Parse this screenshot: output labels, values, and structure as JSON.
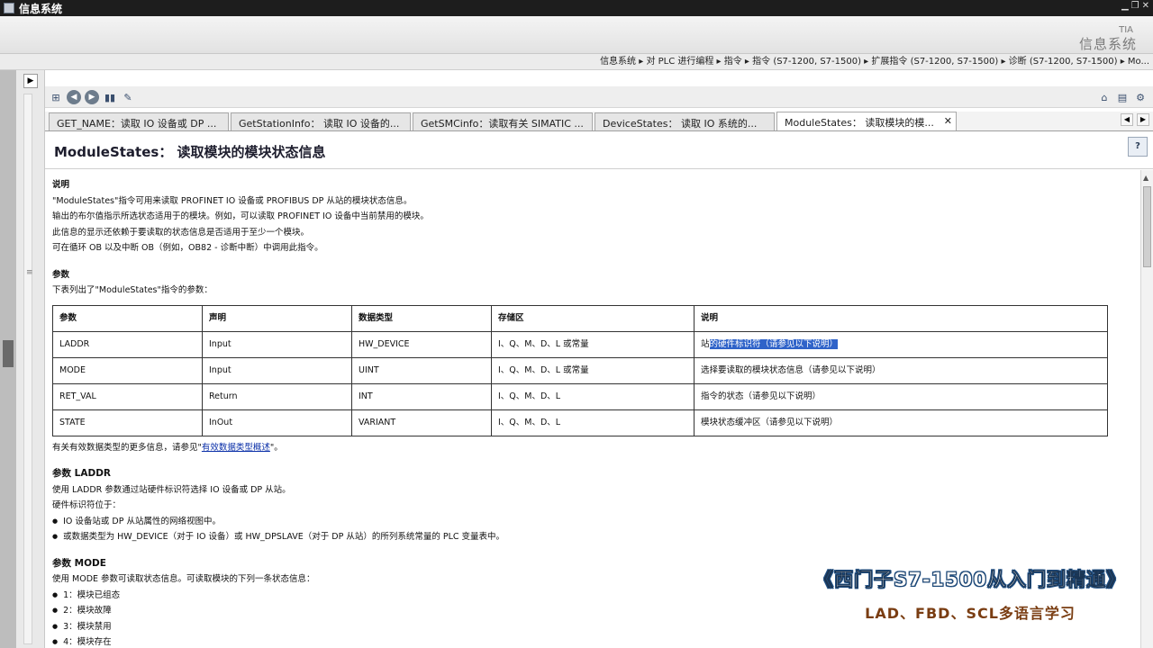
{
  "window": {
    "title": "信息系统",
    "controls": [
      "▁",
      "❐",
      "✕"
    ]
  },
  "brand": {
    "tia": "TIA",
    "name": "信息系统"
  },
  "breadcrumb": "信息系统 ▸ 对 PLC 进行编程 ▸ 指令 ▸ 指令 (S7-1200, S7-1500) ▸ 扩展指令 (S7-1200, S7-1500) ▸ 诊断 (S7-1200, S7-1500) ▸ Mo...",
  "tabs": [
    {
      "label": "GET_NAME：读取 IO 设备或 DP ..."
    },
    {
      "label": "GetStationInfo： 读取 IO 设备的..."
    },
    {
      "label": "GetSMCinfo：读取有关 SIMATIC ..."
    },
    {
      "label": "DeviceStates： 读取 IO 系统的..."
    },
    {
      "label": "ModuleStates： 读取模块的模...",
      "active": true
    }
  ],
  "tab_close": "✕",
  "page": {
    "title": "ModuleStates： 读取模块的模块状态信息"
  },
  "desc": {
    "heading": "说明",
    "lines": [
      "\"ModuleStates\"指令可用来读取 PROFINET IO 设备或 PROFIBUS DP 从站的模块状态信息。",
      "输出的布尔值指示所选状态适用于的模块。例如，可以读取 PROFINET IO 设备中当前禁用的模块。",
      "此信息的显示还依赖于要读取的状态信息是否适用于至少一个模块。",
      "可在循环 OB 以及中断 OB（例如，OB82 - 诊断中断）中调用此指令。"
    ]
  },
  "params": {
    "heading": "参数",
    "intro": "下表列出了\"ModuleStates\"指令的参数：",
    "columns": [
      "参数",
      "声明",
      "数据类型",
      "存储区",
      "说明"
    ],
    "rows": [
      [
        "LADDR",
        "Input",
        "HW_DEVICE",
        "I、Q、M、D、L 或常量",
        "站的硬件标识符（请参见以下说明）"
      ],
      [
        "MODE",
        "Input",
        "UINT",
        "I、Q、M、D、L 或常量",
        "选择要读取的模块状态信息（请参见以下说明）"
      ],
      [
        "RET_VAL",
        "Return",
        "INT",
        "I、Q、M、D、L",
        "指令的状态（请参见以下说明）"
      ],
      [
        "STATE",
        "InOut",
        "VARIANT",
        "I、Q、M、D、L",
        "模块状态缓冲区（请参见以下说明）"
      ]
    ],
    "sel_prefix": "站",
    "sel_text": "的硬件标识符（请参见以下说明）",
    "more_before": "有关有效数据类型的更多信息，请参见\"",
    "more_link": "有效数据类型概述",
    "more_after": "\"。"
  },
  "laddr": {
    "heading": "参数 LADDR",
    "line1": "使用 LADDR 参数通过站硬件标识符选择 IO 设备或 DP 从站。",
    "line2": "硬件标识符位于：",
    "bullets": [
      "IO 设备站或 DP 从站属性的网络视图中。",
      "或数据类型为 HW_DEVICE（对于 IO 设备）或 HW_DPSLAVE（对于 DP 从站）的所列系统常量的 PLC 变量表中。"
    ]
  },
  "mode": {
    "heading": "参数 MODE",
    "line1": "使用 MODE 参数可读取状态信息。可读取模块的下列一条状态信息：",
    "bullets": [
      "1：模块已组态",
      "2：模块故障",
      "3：模块禁用",
      "4：模块存在"
    ]
  },
  "watermark": {
    "line1": "《西门子S7-1500从入门到精通》",
    "line2": "LAD、FBD、SCL多语言学习"
  },
  "colors": {
    "titlebar": "#1d1d1d",
    "selection": "#2f63c9",
    "link": "#0a2fa8"
  }
}
